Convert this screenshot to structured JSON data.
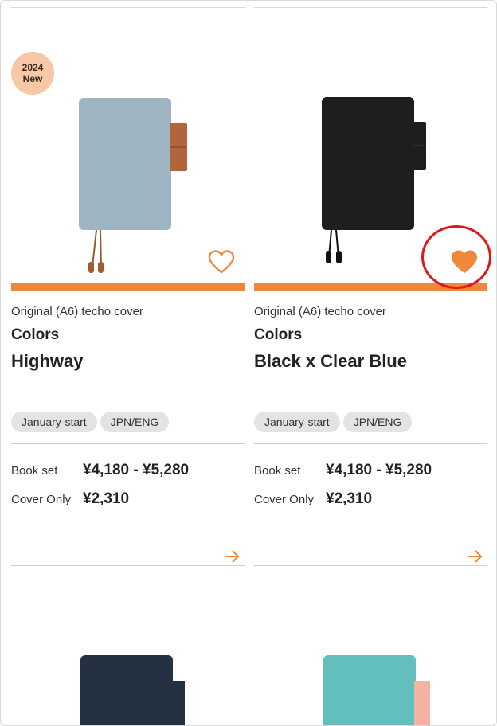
{
  "products": [
    {
      "badge_year": "2024",
      "badge_label": "New",
      "category": "Original (A6) techo cover",
      "series": "Colors",
      "name": "Highway",
      "tags": [
        "January-start",
        "JPN/ENG"
      ],
      "book_set_label": "Book set",
      "book_set_price": "¥4,180 - ¥5,280",
      "cover_only_label": "Cover Only",
      "cover_only_price": "¥2,310",
      "favorited": false,
      "cover_color": "#9fb4c3",
      "tab_color": "#b0663a"
    },
    {
      "category": "Original (A6) techo cover",
      "series": "Colors",
      "name": "Black x Clear Blue",
      "tags": [
        "January-start",
        "JPN/ENG"
      ],
      "book_set_label": "Book set",
      "book_set_price": "¥4,180 - ¥5,280",
      "cover_only_label": "Cover Only",
      "cover_only_price": "¥2,310",
      "favorited": true,
      "cover_color": "#1e1e1e",
      "tab_color": "#1e1e1e"
    }
  ],
  "next_row_covers": [
    "#243142",
    "#62bfbe"
  ],
  "colors": {
    "accent": "#f0883a",
    "badge_bg": "#f6c8a6",
    "tag_bg": "#e3e3e3",
    "highlight": "#e01818"
  },
  "icons": {
    "favorite": "heart-icon",
    "detail": "arrow-right-icon"
  }
}
